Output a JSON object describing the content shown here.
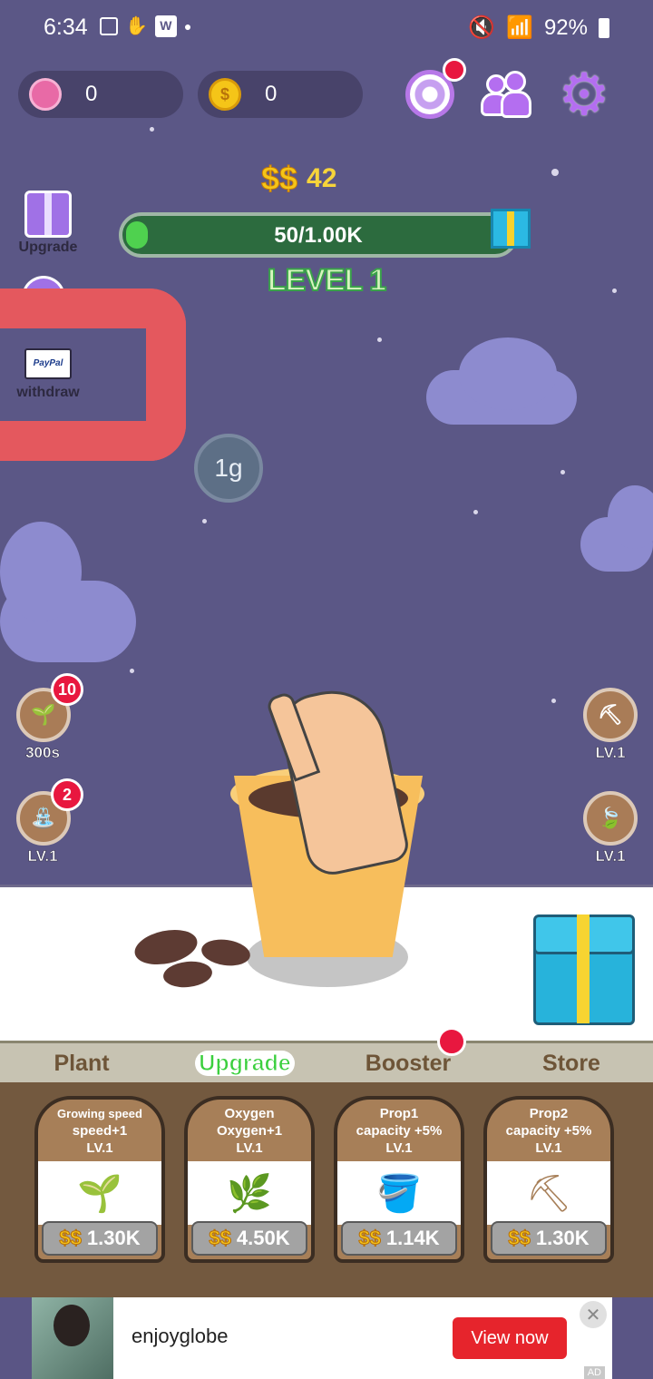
{
  "status_bar": {
    "time": "6:34",
    "battery": "92%"
  },
  "currencies": {
    "gems": "0",
    "coins": "0"
  },
  "cash": {
    "amount": "42"
  },
  "progress": {
    "text": "50/1.00K",
    "fraction": 0.05
  },
  "level": "LEVEL 1",
  "left_side": {
    "upgrade_label": "Upgrade",
    "withdraw_label": "withdraw",
    "paypal_text": "PayPal"
  },
  "bubble": "1g",
  "seed_button": {
    "badge": "10",
    "label": "300s"
  },
  "water_button": {
    "badge": "2",
    "label": "LV.1"
  },
  "shovel_button": {
    "label": "LV.1"
  },
  "fertilizer_button": {
    "label": "LV.1"
  },
  "tabs": [
    "Plant",
    "Upgrade",
    "Booster",
    "Store"
  ],
  "active_tab": "Upgrade",
  "cards": [
    {
      "line1": "Growing speed",
      "line2": "speed+1",
      "line3": "LV.1",
      "icon": "plant-hand-icon",
      "price": "1.30K"
    },
    {
      "line1": "Oxygen",
      "line2": "Oxygen+1",
      "line3": "LV.1",
      "icon": "leaf-icon",
      "price": "4.50K"
    },
    {
      "line1": "Prop1",
      "line2": "capacity +5%",
      "line3": "LV.1",
      "icon": "watering-can-icon",
      "price": "1.14K"
    },
    {
      "line1": "Prop2",
      "line2": "capacity +5%",
      "line3": "LV.1",
      "icon": "shovel-icon",
      "price": "1.30K"
    }
  ],
  "ad": {
    "name": "enjoyglobe",
    "button": "View now",
    "tag": "AD"
  },
  "colors": {
    "sky": "#5b5786",
    "accent_green": "#3bcf3e",
    "card_brown": "#a77f58",
    "badge_red": "#e8173f"
  }
}
